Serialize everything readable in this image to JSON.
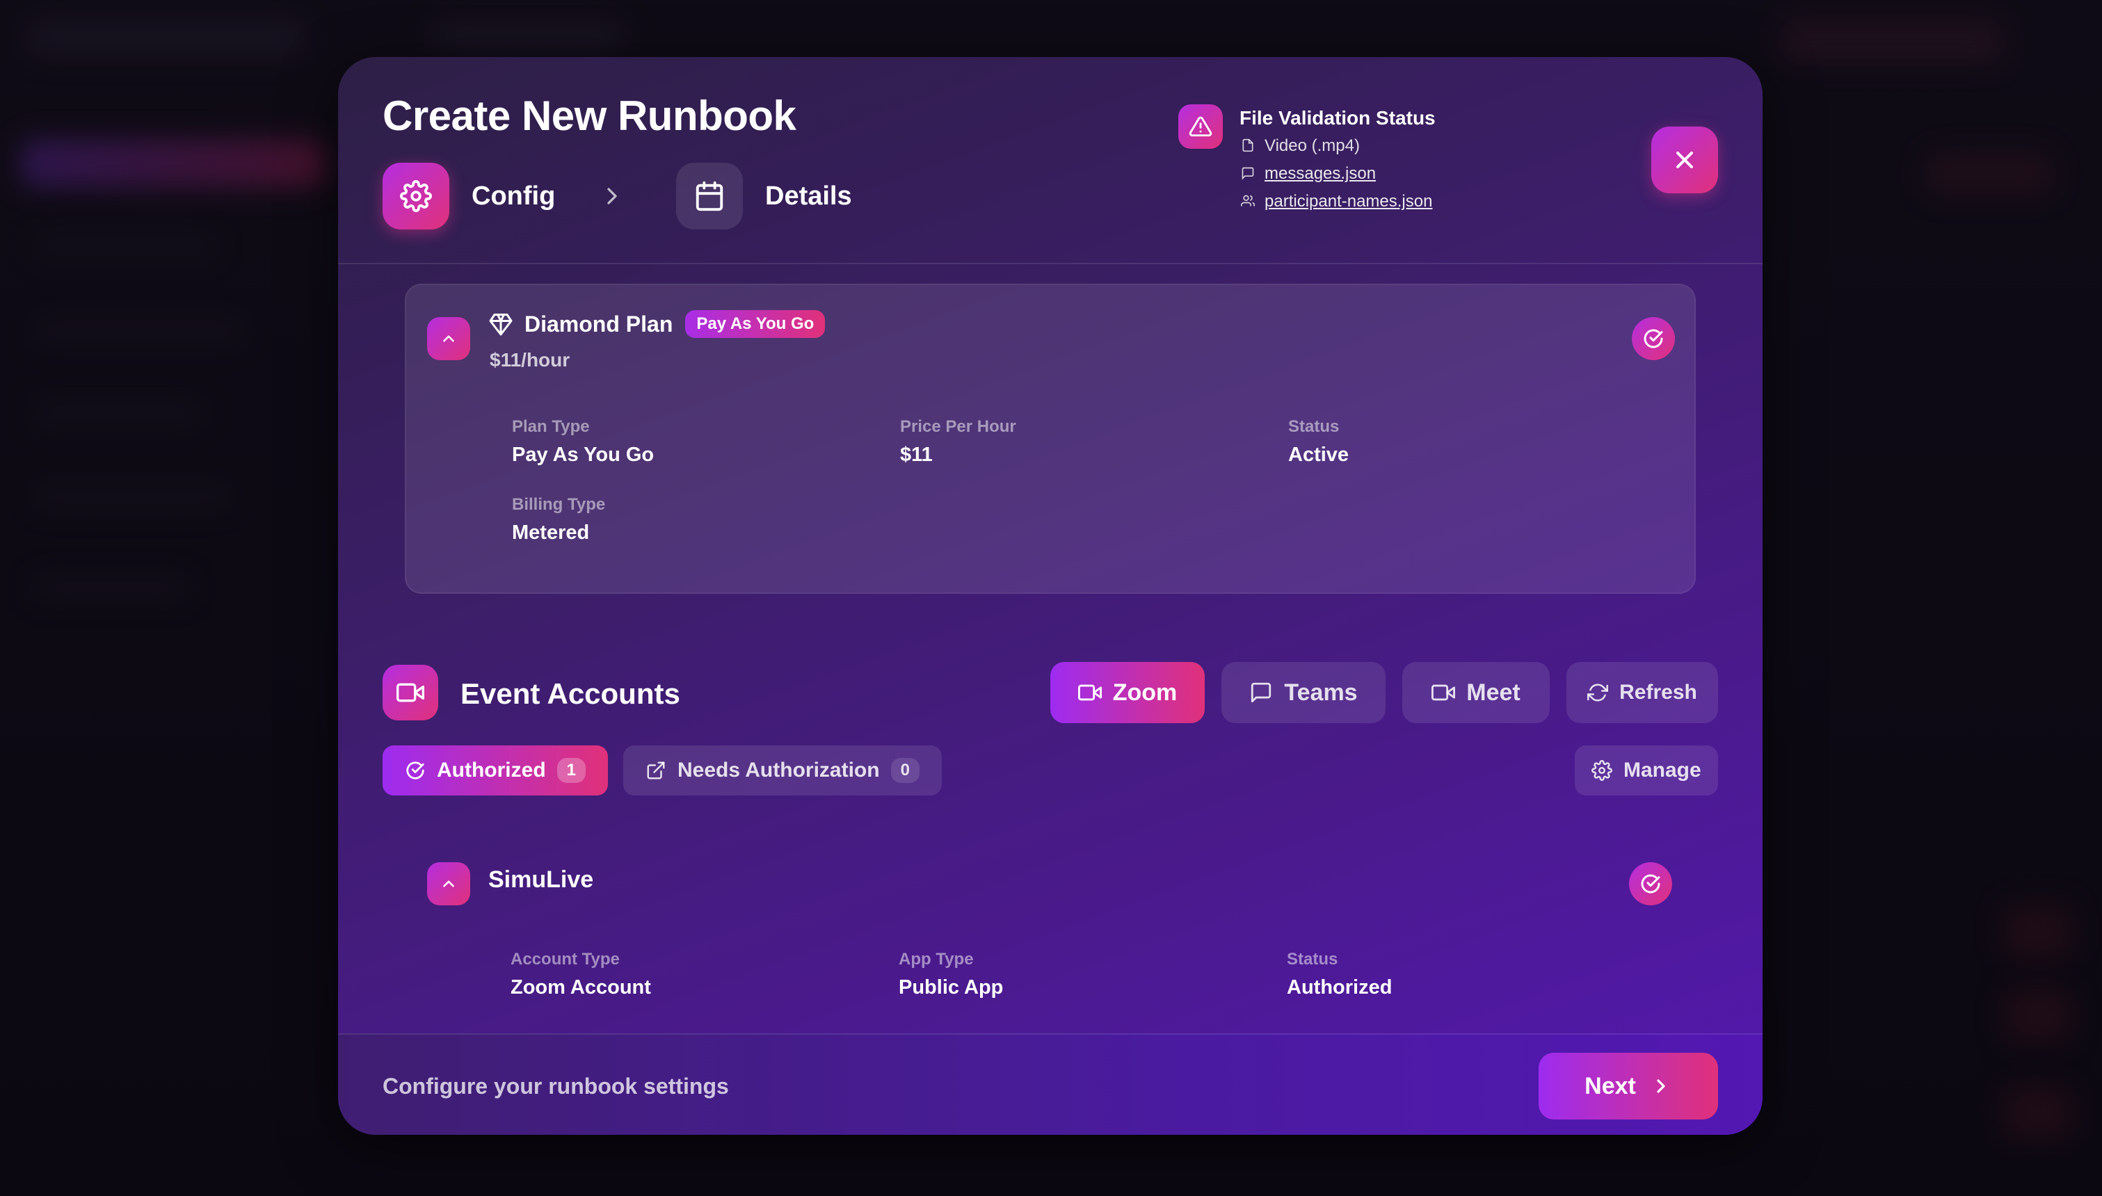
{
  "modal": {
    "title": "Create New Runbook",
    "steps": [
      {
        "label": "Config",
        "icon": "gear-icon",
        "active": true
      },
      {
        "label": "Details",
        "icon": "calendar-icon",
        "active": false
      }
    ],
    "file_validation": {
      "title": "File Validation Status",
      "items": [
        {
          "label": "Video (.mp4)",
          "icon": "file-icon",
          "link": false
        },
        {
          "label": "messages.json",
          "icon": "message-icon",
          "link": true
        },
        {
          "label": "participant-names.json",
          "icon": "users-icon",
          "link": true
        }
      ]
    }
  },
  "plan": {
    "name": "Diamond Plan",
    "badge": "Pay As You Go",
    "price": "$11/hour",
    "fields": [
      {
        "key": "Plan Type",
        "value": "Pay As You Go"
      },
      {
        "key": "Price Per Hour",
        "value": "$11"
      },
      {
        "key": "Status",
        "value": "Active"
      },
      {
        "key": "Billing Type",
        "value": "Metered"
      }
    ]
  },
  "event_accounts": {
    "title": "Event Accounts",
    "tabs": [
      {
        "label": "Zoom",
        "active": true
      },
      {
        "label": "Teams",
        "active": false
      },
      {
        "label": "Meet",
        "active": false
      }
    ],
    "refresh_label": "Refresh",
    "filters": [
      {
        "label": "Authorized",
        "count": "1",
        "active": true
      },
      {
        "label": "Needs Authorization",
        "count": "0",
        "active": false
      }
    ],
    "manage_label": "Manage",
    "account": {
      "name": "SimuLive",
      "fields": [
        {
          "key": "Account Type",
          "value": "Zoom Account"
        },
        {
          "key": "App Type",
          "value": "Public App"
        },
        {
          "key": "Status",
          "value": "Authorized"
        }
      ]
    }
  },
  "footer": {
    "hint": "Configure your runbook settings",
    "next_label": "Next"
  },
  "colors": {
    "accent_start": "#9d2cf0",
    "accent_end": "#e0317a",
    "modal_bg": "#4a1a8c"
  }
}
